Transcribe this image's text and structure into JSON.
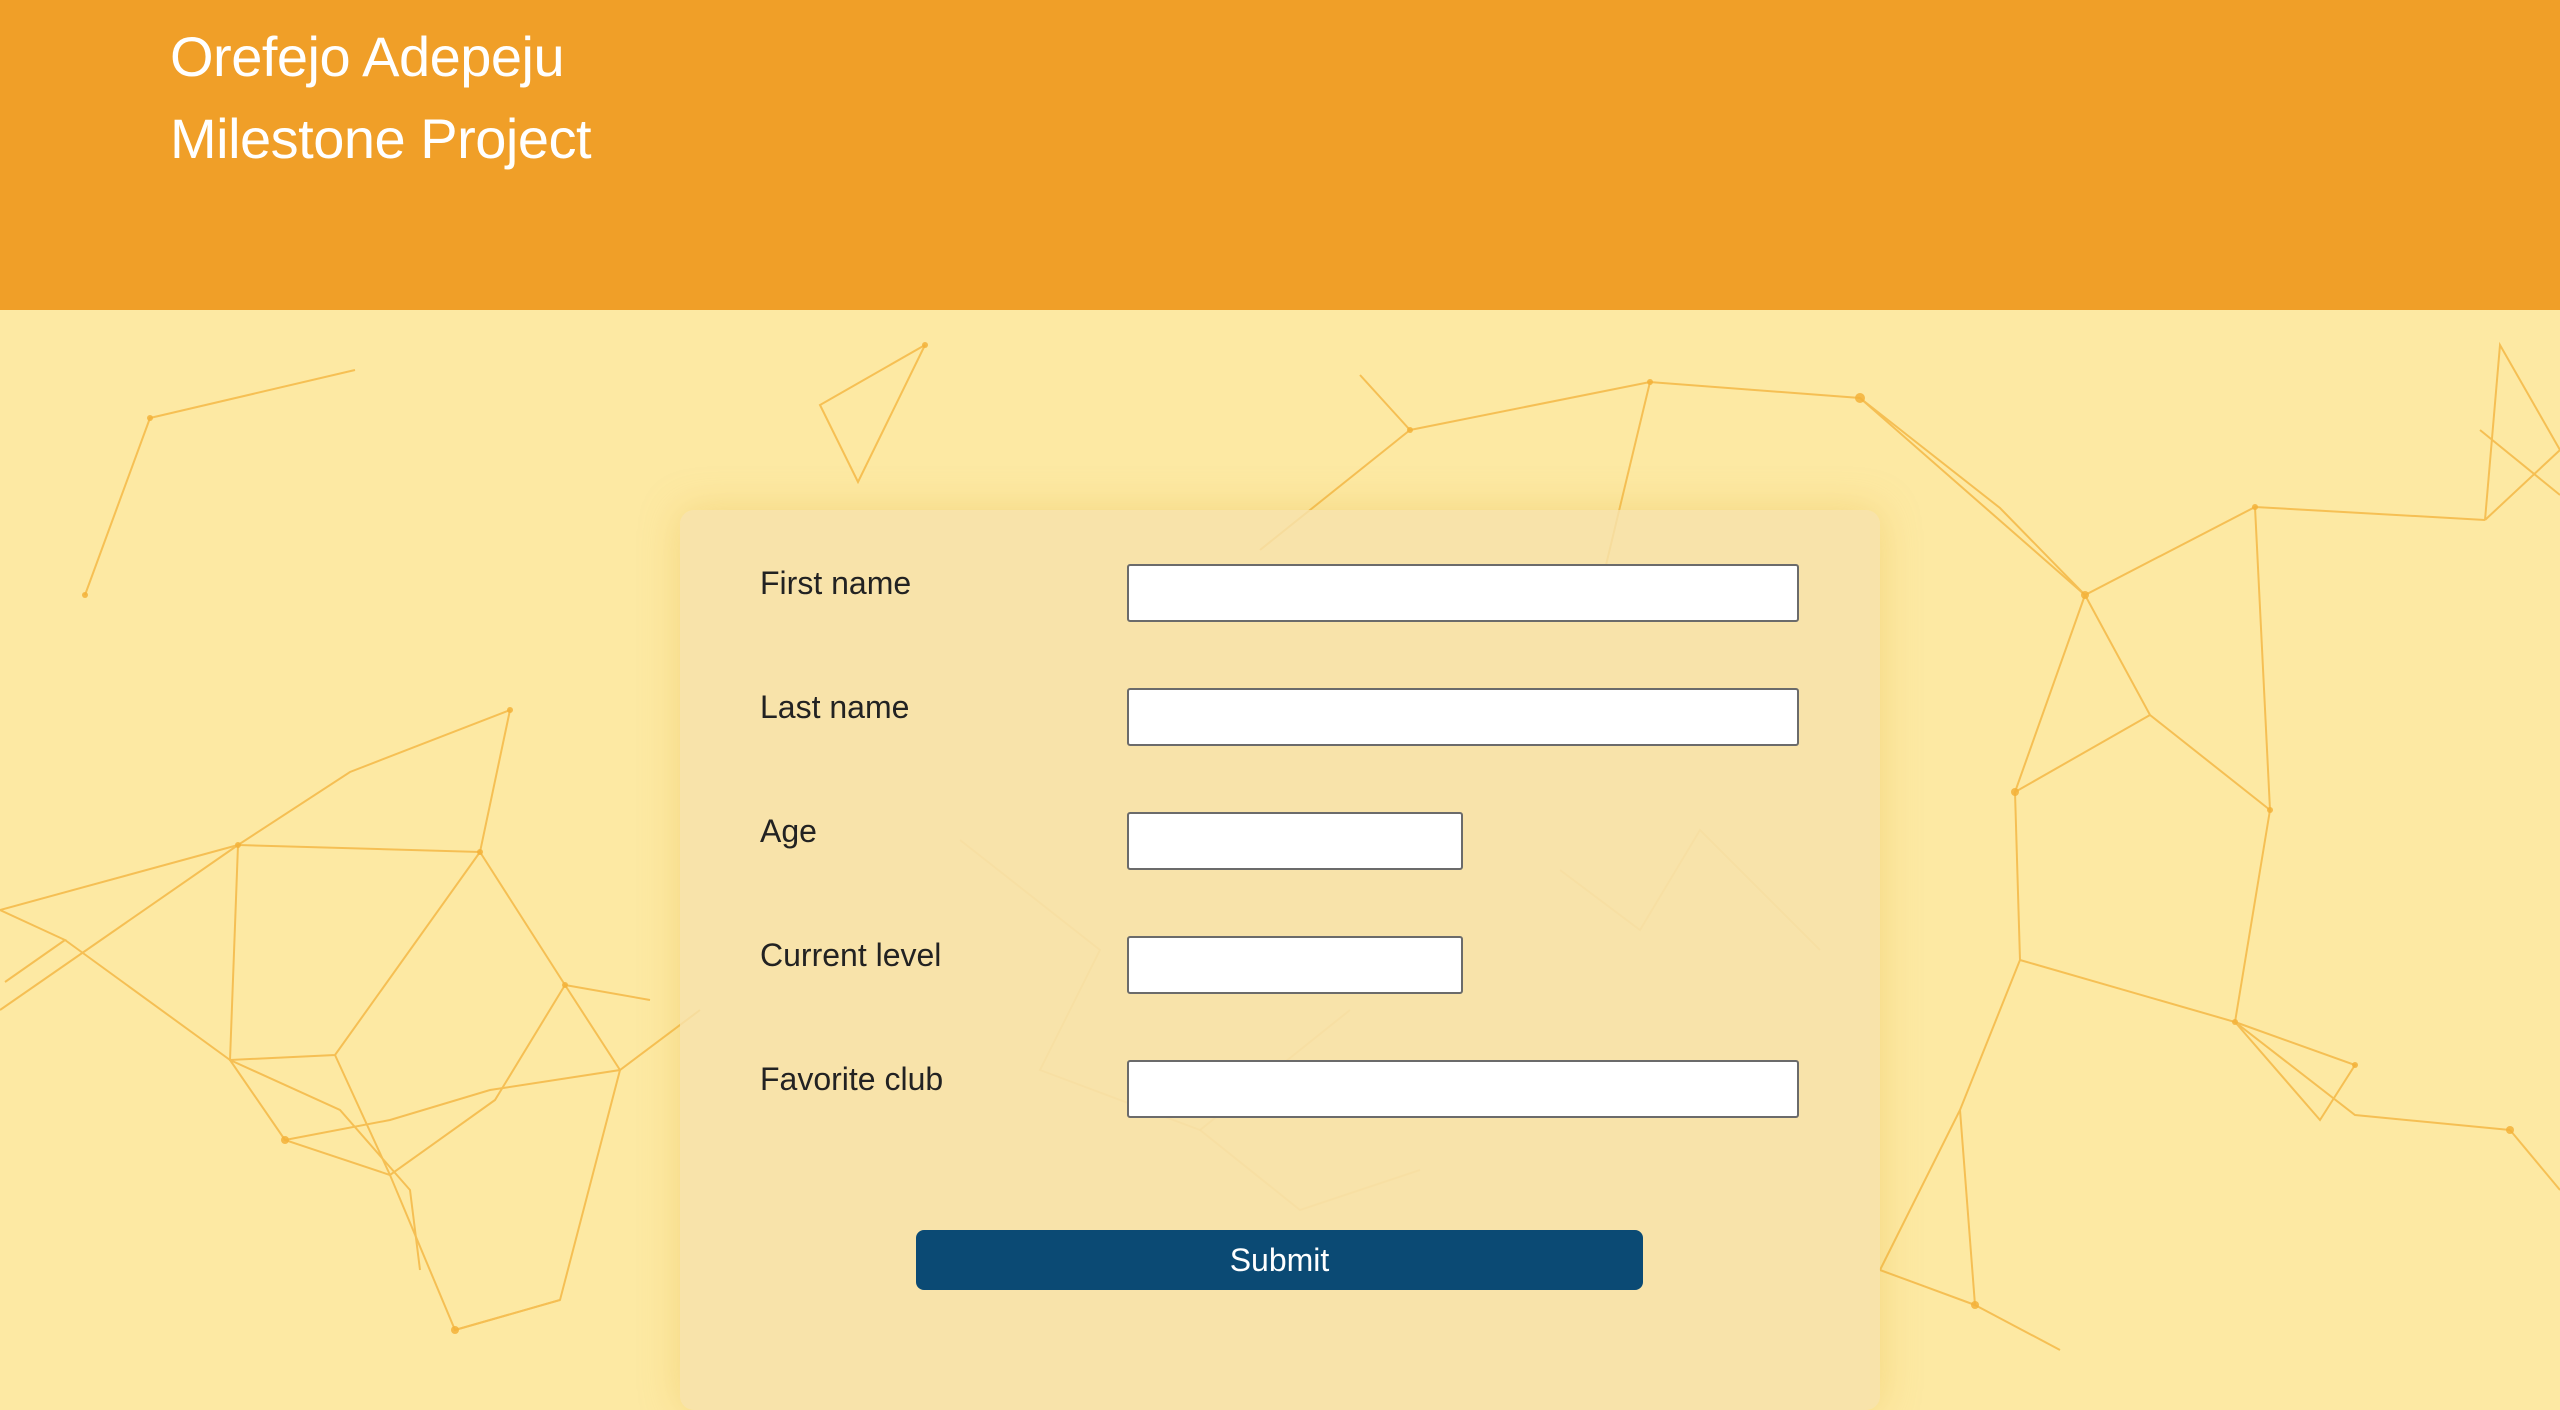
{
  "header": {
    "name": "Orefejo Adepeju",
    "subtitle": "Milestone Project",
    "background_color": "#f09f28"
  },
  "form": {
    "fields": [
      {
        "label": "First name",
        "value": "",
        "size": "long"
      },
      {
        "label": "Last name",
        "value": "",
        "size": "long"
      },
      {
        "label": "Age",
        "value": "",
        "size": "short"
      },
      {
        "label": "Current level",
        "value": "",
        "size": "short"
      },
      {
        "label": "Favorite club",
        "value": "",
        "size": "long"
      }
    ],
    "submit_label": "Submit",
    "submit_color": "#0b4a74"
  },
  "page": {
    "background_color": "#fde9a3",
    "network_color": "#f3b23a"
  }
}
